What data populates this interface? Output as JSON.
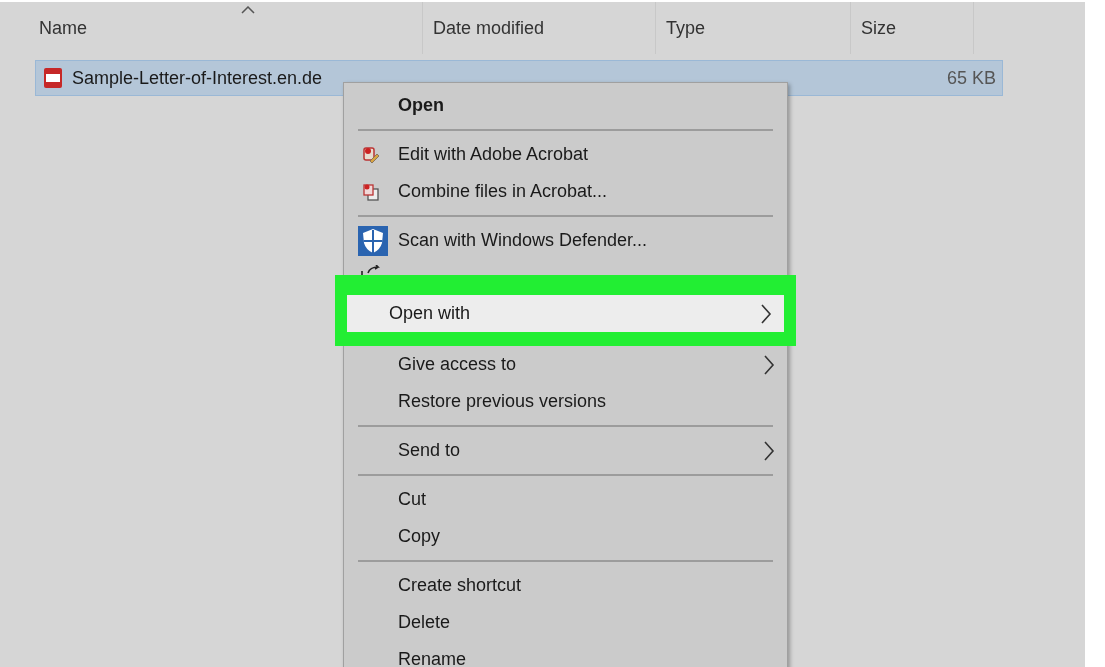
{
  "columns": [
    {
      "label": "Name",
      "sorted": true
    },
    {
      "label": "Date modified",
      "sorted": false
    },
    {
      "label": "Type",
      "sorted": false
    },
    {
      "label": "Size",
      "sorted": false
    }
  ],
  "rows": [
    {
      "name": "Sample-Letter-of-Interest.en.de",
      "size": "65 KB",
      "selected": true
    }
  ],
  "context_menu": [
    {
      "kind": "default",
      "label": "Open",
      "selected": false
    },
    {
      "kind": "separator"
    },
    {
      "kind": "acrobat_edit",
      "label": "Edit with Adobe Acrobat",
      "selected": false
    },
    {
      "kind": "acrobat_combine",
      "label": "Combine files in Acrobat...",
      "selected": false
    },
    {
      "kind": "separator"
    },
    {
      "kind": "defender",
      "label": "Scan with Windows Defender...",
      "selected": false
    },
    {
      "kind": "covered"
    },
    {
      "kind": "submenu",
      "label": "Open with",
      "selected": true
    },
    {
      "kind": "submenu",
      "label": "Give access to",
      "selected": false
    },
    {
      "kind": "plain",
      "label": "Restore previous versions",
      "selected": false
    },
    {
      "kind": "separator"
    },
    {
      "kind": "submenu",
      "label": "Send to",
      "selected": false
    },
    {
      "kind": "separator"
    },
    {
      "kind": "plain",
      "label": "Cut",
      "selected": false
    },
    {
      "kind": "plain",
      "label": "Copy",
      "selected": false
    },
    {
      "kind": "separator"
    },
    {
      "kind": "plain",
      "label": "Create shortcut",
      "selected": false
    },
    {
      "kind": "plain",
      "label": "Delete",
      "selected": false
    },
    {
      "kind": "plain",
      "label": "Rename",
      "selected": false
    }
  ]
}
